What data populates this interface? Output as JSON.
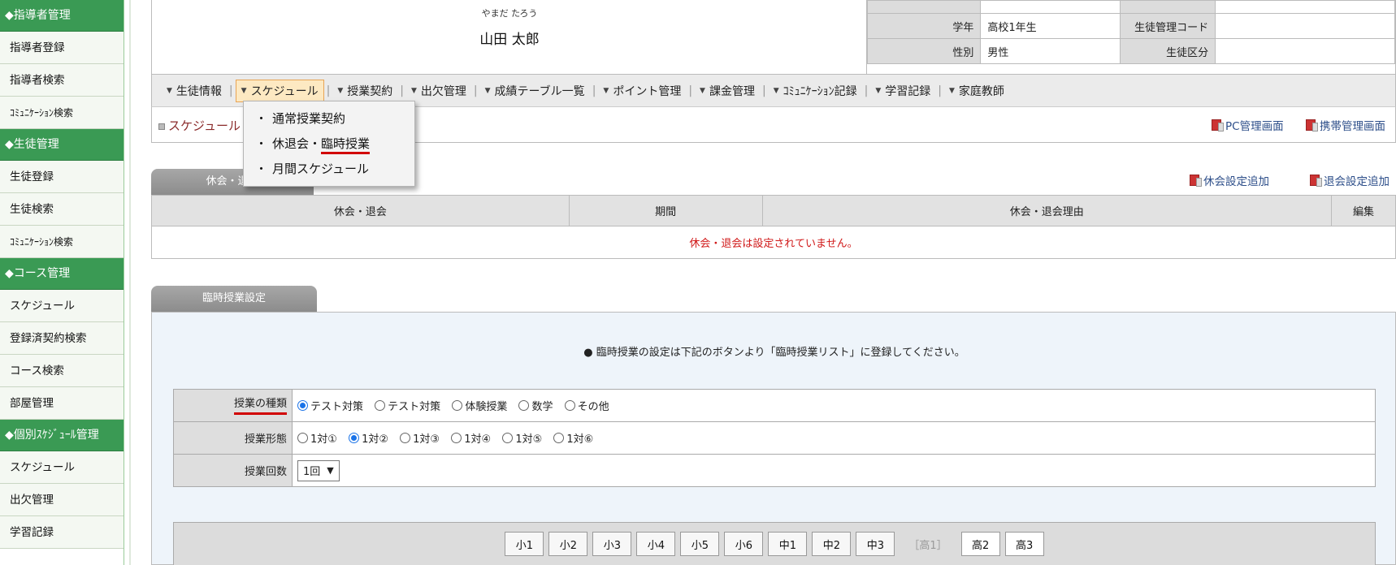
{
  "sidebar": {
    "groups": [
      {
        "header": "◆指導者管理",
        "items": [
          "指導者登録",
          "指導者検索",
          "ｺﾐｭﾆｹｰｼｮﾝ検索"
        ]
      },
      {
        "header": "◆生徒管理",
        "items": [
          "生徒登録",
          "生徒検索",
          "ｺﾐｭﾆｹｰｼｮﾝ検索"
        ]
      },
      {
        "header": "◆コース管理",
        "items": [
          "スケジュール",
          "登録済契約検索",
          "コース検索",
          "部屋管理"
        ]
      },
      {
        "header": "◆個別ｽｹｼﾞｭｰﾙ管理",
        "items": [
          "スケジュール",
          "出欠管理",
          "学習記録"
        ]
      }
    ]
  },
  "profile": {
    "kana": "やまだ たろう",
    "name": "山田 太郎",
    "grade_label": "学年",
    "grade_value": "高校1年生",
    "code_label": "生徒管理コード",
    "code_value": "",
    "gender_label": "性別",
    "gender_value": "男性",
    "category_label": "生徒区分",
    "category_value": ""
  },
  "menu": [
    "生徒情報",
    "スケジュール",
    "授業契約",
    "出欠管理",
    "成績テーブル一覧",
    "ポイント管理",
    "課金管理",
    "ｺﾐｭﾆｹｰｼｮﾝ記録",
    "学習記録",
    "家庭教師"
  ],
  "menu_active": "スケジュール",
  "dropdown": {
    "item1": "通常授業契約",
    "item2_prefix": "休退会・",
    "item2_highlight": "臨時授業",
    "item3": "月間スケジュール"
  },
  "breadcrumb": "スケジュール ＞",
  "page_links": {
    "pc": "PC管理画面",
    "mobile": "携帯管理画面"
  },
  "kyukai": {
    "tab": "休会・退会",
    "add_kyukai": "休会設定追加",
    "add_taikai": "退会設定追加",
    "headers": [
      "休会・退会",
      "期間",
      "休会・退会理由",
      "編集"
    ],
    "empty_message": "休会・退会は設定されていません。"
  },
  "rinji": {
    "tab": "臨時授業設定",
    "note": "● 臨時授業の設定は下記のボタンより「臨時授業リスト」に登録してください。",
    "type_label": "授業の種類",
    "type_options": [
      "テスト対策",
      "テスト対策",
      "体験授業",
      "数学",
      "その他"
    ],
    "type_selected": 0,
    "form_label": "授業形態",
    "form_options": [
      "1対①",
      "1対②",
      "1対③",
      "1対④",
      "1対⑤",
      "1対⑥"
    ],
    "form_selected": 1,
    "count_label": "授業回数",
    "count_value": "1回",
    "grades": [
      "小1",
      "小2",
      "小3",
      "小4",
      "小5",
      "小6",
      "中1",
      "中2",
      "中3",
      "［高1］",
      "高2",
      "高3"
    ],
    "grade_disabled": 9
  },
  "colors": {
    "sidebar_header": "#3a9a54",
    "tab_gray": "#999999",
    "empty_red": "#d01818",
    "underline_red": "#d10000",
    "radio_blue": "#1a73e8"
  }
}
